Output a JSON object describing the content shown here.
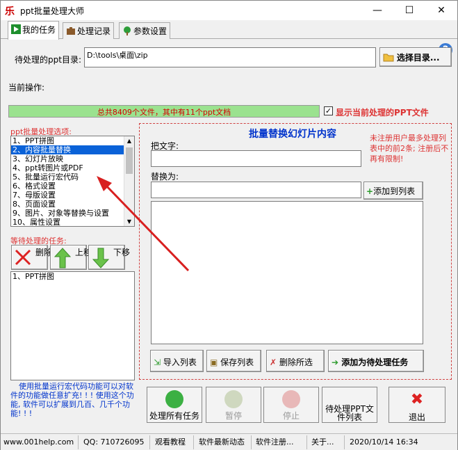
{
  "window": {
    "title": "ppt批量处理大师",
    "controls": [
      "—",
      "☐",
      "✕"
    ]
  },
  "tabs": [
    {
      "label": "我的任务",
      "active": true
    },
    {
      "label": "处理记录",
      "active": false
    },
    {
      "label": "参数设置",
      "active": false
    }
  ],
  "dir": {
    "label": "待处理的ppt目录:",
    "value": "D:\\tools\\桌面\\zip",
    "select_button": "选择目录..."
  },
  "current_op_label": "当前操作:",
  "progress": {
    "text": "总共8409个文件，其中有11个ppt文档",
    "fraction": 1.0
  },
  "show_current": {
    "label": "显示当前处理的PPT文件",
    "checked": true
  },
  "options": {
    "title": "ppt批量处理选项:",
    "items": [
      "1、PPT拼图",
      "2、内容批量替换",
      "3、幻灯片放映",
      "4、ppt转图片或PDF",
      "5、批量运行宏代码",
      "6、格式设置",
      "7、母版设置",
      "8、页面设置",
      "9、图片、对象等替换与设置",
      "10、属性设置"
    ],
    "selected_index": 1
  },
  "pending": {
    "title": "等待处理的任务:",
    "delete_label": "删除",
    "up_label": "上移",
    "down_label": "下移",
    "items": [
      "1、PPT拼图"
    ]
  },
  "panel": {
    "title": "批量替换幻灯片内容",
    "notice": "未注册用户最多处理列表中的前2条; 注册后不再有限制!",
    "find_label": "把文字:",
    "replace_label": "替换为:",
    "add_to_list": "添加到列表",
    "import_list": "导入列表",
    "save_list": "保存列表",
    "delete_selected": "删除所选",
    "add_task": "添加为待处理任务"
  },
  "macro_tip": "使用批量运行宏代码功能可以对软件的功能做任意扩充! ! ! 使用这个功能, 软件可以扩展到几百、几千个功能! ! !",
  "actions": {
    "process_all": "处理所有任务",
    "pause": "暂停",
    "stop": "停止",
    "pending_list": "待处理PPT文件列表",
    "exit": "退出"
  },
  "statusbar": {
    "website": "www.001help.com",
    "qq": "QQ: 710726095",
    "tutorial": "观看教程",
    "news": "软件最新动态",
    "register": "软件注册...",
    "about": "关于...",
    "datetime": "2020/10/14   16:34"
  },
  "colors": {
    "accent_red": "#d33333",
    "panel_blue": "#0033cc",
    "progress_fill": "#9be28f",
    "selection": "#0a62d8"
  }
}
